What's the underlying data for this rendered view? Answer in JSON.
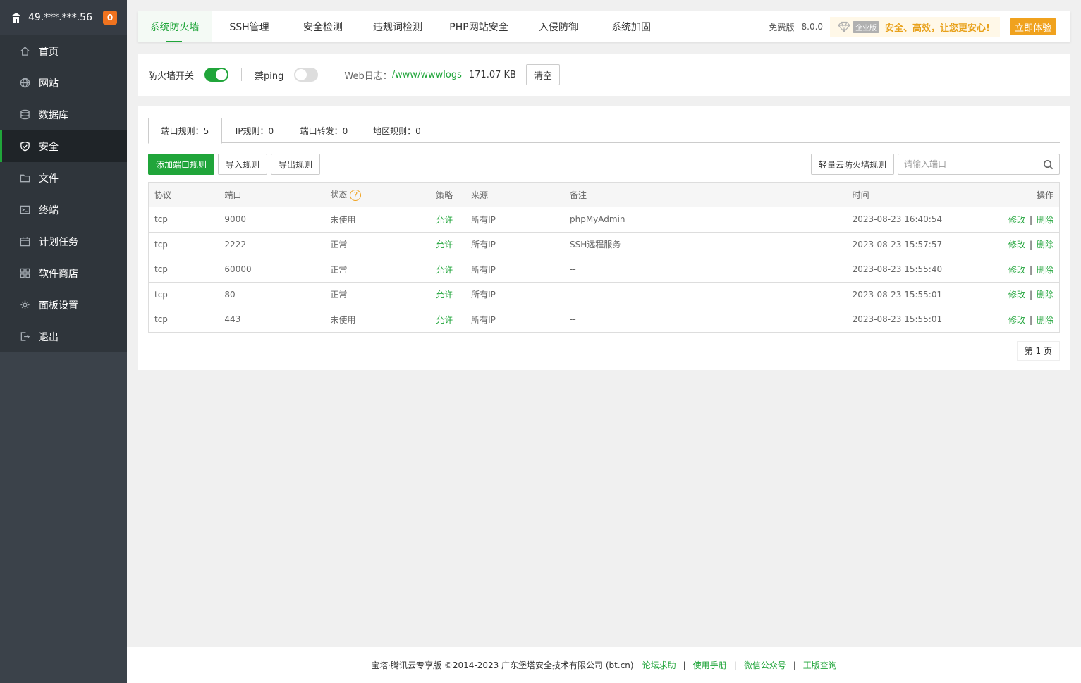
{
  "sidebar": {
    "server_ip": "49.***.***.56",
    "notify_count": "0",
    "items": [
      {
        "label": "首页"
      },
      {
        "label": "网站"
      },
      {
        "label": "数据库"
      },
      {
        "label": "安全"
      },
      {
        "label": "文件"
      },
      {
        "label": "终端"
      },
      {
        "label": "计划任务"
      },
      {
        "label": "软件商店"
      },
      {
        "label": "面板设置"
      },
      {
        "label": "退出"
      }
    ],
    "active_index": 3
  },
  "topbar": {
    "tabs": [
      {
        "label": "系统防火墙"
      },
      {
        "label": "SSH管理"
      },
      {
        "label": "安全检测"
      },
      {
        "label": "违规词检测"
      },
      {
        "label": "PHP网站安全"
      },
      {
        "label": "入侵防御"
      },
      {
        "label": "系统加固"
      }
    ],
    "edition": "免费版",
    "version": "8.0.0",
    "enterprise_tag": "企业版",
    "slogan": "安全、高效，让您更安心!",
    "try_button": "立即体验"
  },
  "switches": {
    "firewall_label": "防火墙开关",
    "firewall_on": true,
    "ping_label": "禁ping",
    "ping_on": false,
    "weblog_label": "Web日志：",
    "weblog_path": "/www/wwwlogs",
    "weblog_size": "171.07 KB",
    "clear_button": "清空"
  },
  "rule_tabs": [
    {
      "label": "端口规则：5"
    },
    {
      "label": "IP规则：0"
    },
    {
      "label": "端口转发：0"
    },
    {
      "label": "地区规则：0"
    }
  ],
  "toolbar": {
    "add_button": "添加端口规则",
    "import_button": "导入规则",
    "export_button": "导出规则",
    "cloud_button": "轻量云防火墙规则",
    "search_placeholder": "请输入端口"
  },
  "table": {
    "headers": [
      "协议",
      "端口",
      "状态",
      "策略",
      "来源",
      "备注",
      "时间",
      "操作"
    ],
    "help_icon_text": "?",
    "rows": [
      {
        "protocol": "tcp",
        "port": "9000",
        "status": "未使用",
        "policy": "允许",
        "source": "所有IP",
        "note": "phpMyAdmin",
        "time": "2023-08-23 16:40:54",
        "edit": "修改",
        "sep": "|",
        "delete": "删除"
      },
      {
        "protocol": "tcp",
        "port": "2222",
        "status": "正常",
        "policy": "允许",
        "source": "所有IP",
        "note": "SSH远程服务",
        "time": "2023-08-23 15:57:57",
        "edit": "修改",
        "sep": "|",
        "delete": "删除"
      },
      {
        "protocol": "tcp",
        "port": "60000",
        "status": "正常",
        "policy": "允许",
        "source": "所有IP",
        "note": "--",
        "time": "2023-08-23 15:55:40",
        "edit": "修改",
        "sep": "|",
        "delete": "删除"
      },
      {
        "protocol": "tcp",
        "port": "80",
        "status": "正常",
        "policy": "允许",
        "source": "所有IP",
        "note": "--",
        "time": "2023-08-23 15:55:01",
        "edit": "修改",
        "sep": "|",
        "delete": "删除"
      },
      {
        "protocol": "tcp",
        "port": "443",
        "status": "未使用",
        "policy": "允许",
        "source": "所有IP",
        "note": "--",
        "time": "2023-08-23 15:55:01",
        "edit": "修改",
        "sep": "|",
        "delete": "删除"
      }
    ]
  },
  "pager": {
    "label": "第 1 页"
  },
  "footer": {
    "copyright": "宝塔·腾讯云专享版 ©2014-2023 广东堡塔安全技术有限公司 (bt.cn)",
    "separator": "|",
    "links": [
      "论坛求助",
      "使用手册",
      "微信公众号",
      "正版查询"
    ]
  },
  "colors": {
    "accent": "#20a53a",
    "warning": "#f0a21e",
    "sidebar_bg": "#3b424a"
  }
}
